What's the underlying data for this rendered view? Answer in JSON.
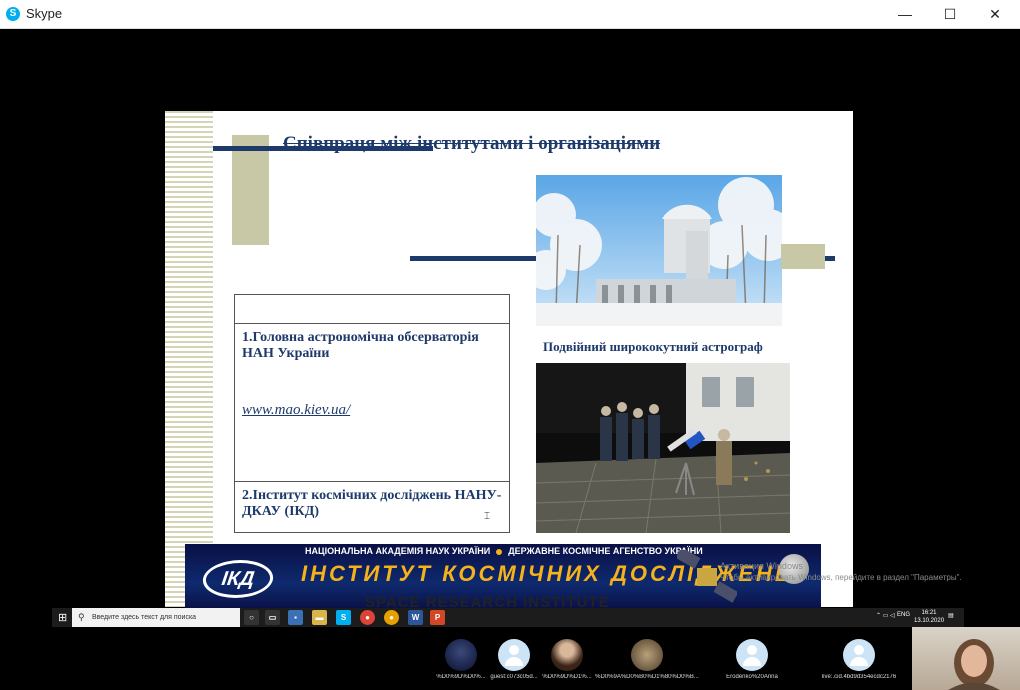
{
  "window": {
    "title": "Skype",
    "logo_letter": "S",
    "minimize": "—",
    "maximize": "☐",
    "close": "✕"
  },
  "slide": {
    "title": "Співпраця між інститутами і організаціями",
    "photo_caption": "Подвійний ширококутний астрограф",
    "table": {
      "row1_title": "1.Головна астрономічна обсерваторія НАН України",
      "row1_link": "www.mao.kiev.ua/",
      "row2_title": "2.Інститут космічних досліджень НАНУ-ДКАУ (ІКД)"
    },
    "banner": {
      "top_left": "НАЦІОНАЛЬНА АКАДЕМІЯ НАУК УКРАЇНИ",
      "top_right": "ДЕРЖАВНЕ КОСМІЧНЕ АГЕНСТВО УКРАЇНИ",
      "logo_text": "ІКД",
      "title": "ІНСТИТУТ КОСМІЧНИХ ДОСЛІДЖЕНЬ",
      "subtitle": "SPACE RESEARCH INSTITUTE"
    }
  },
  "activation": {
    "line1": "Активация Windows",
    "line2": "Чтобы активировать Windows, перейдите в раздел \"Параметры\"."
  },
  "taskbar": {
    "search_placeholder": "Введите здесь текст для поиска",
    "lang": "ENG",
    "time": "16:21",
    "date": "13.10.2020"
  },
  "participants": [
    {
      "name": "%D0%9D%D0%..."
    },
    {
      "name": "guest:c073c05d..."
    },
    {
      "name": "%D0%9D%D1%..."
    },
    {
      "name": "%D0%9A%D0%B0%D1%80%D0%B..."
    },
    {
      "name": "Erodenko%20Anna"
    },
    {
      "name": "live:.cid.4bd9d354ecdc2176"
    }
  ]
}
